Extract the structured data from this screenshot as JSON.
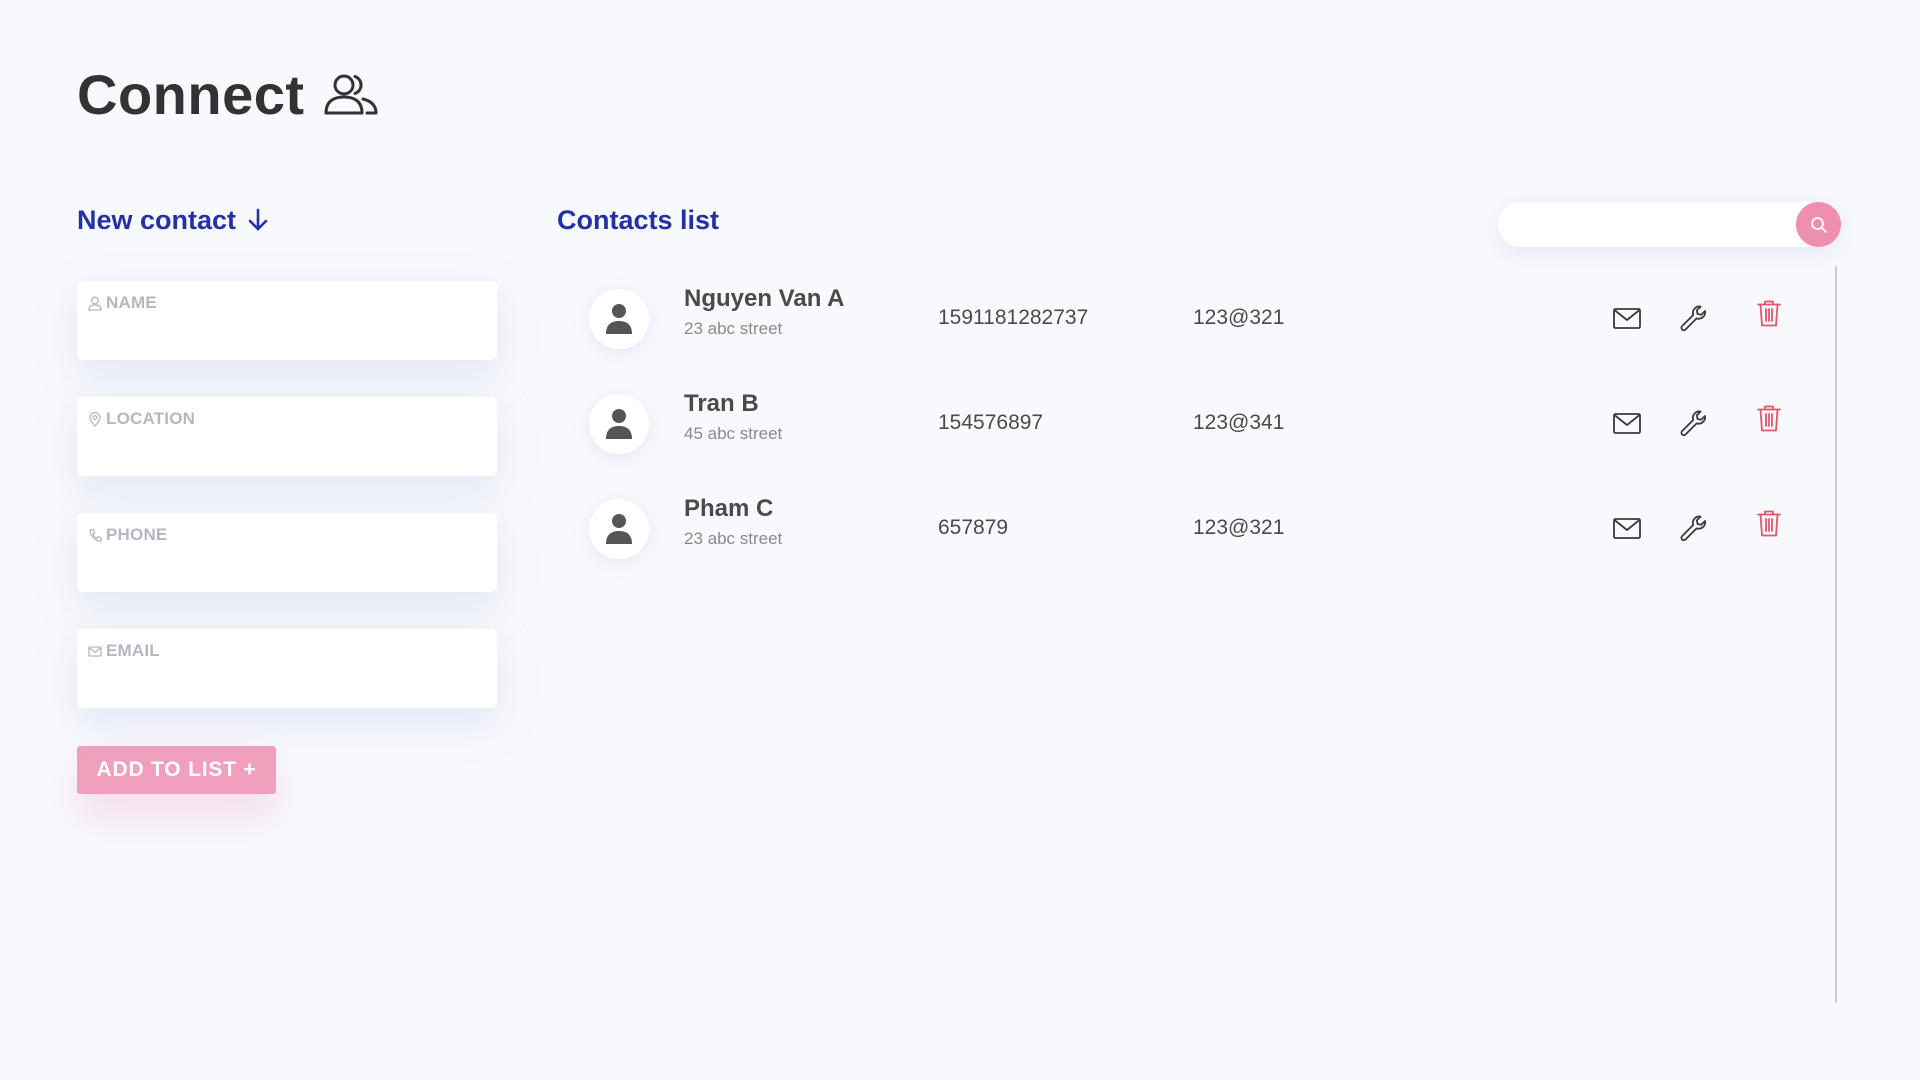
{
  "app": {
    "title": "Connect",
    "icon": "users-icon"
  },
  "new_contact": {
    "title": "New contact",
    "title_icon": "arrow-down-icon",
    "fields": [
      {
        "label": "NAME",
        "icon": "user-icon",
        "value": ""
      },
      {
        "label": "LOCATION",
        "icon": "map-pin-icon",
        "value": ""
      },
      {
        "label": "PHONE",
        "icon": "phone-icon",
        "value": ""
      },
      {
        "label": "EMAIL",
        "icon": "mail-icon",
        "value": ""
      }
    ],
    "add_button_label": "ADD TO LIST +"
  },
  "contacts_list": {
    "title": "Contacts list",
    "search": {
      "value": "",
      "icon": "search-icon"
    },
    "contacts": [
      {
        "name": "Nguyen Van A",
        "address": "23 abc street",
        "phone": "1591181282737",
        "email": "123@321"
      },
      {
        "name": "Tran B",
        "address": "45 abc street",
        "phone": "154576897",
        "email": "123@341"
      },
      {
        "name": "Pham C",
        "address": "23 abc street",
        "phone": "657879",
        "email": "123@321"
      }
    ],
    "row_actions": [
      "mail-icon",
      "wrench-icon",
      "trash-icon"
    ]
  },
  "colors": {
    "background": "#f8f9fd",
    "title_text": "#333333",
    "section_title": "#2331a6",
    "accent_pink": "#f0a0bd",
    "delete_red": "#e8546a"
  }
}
